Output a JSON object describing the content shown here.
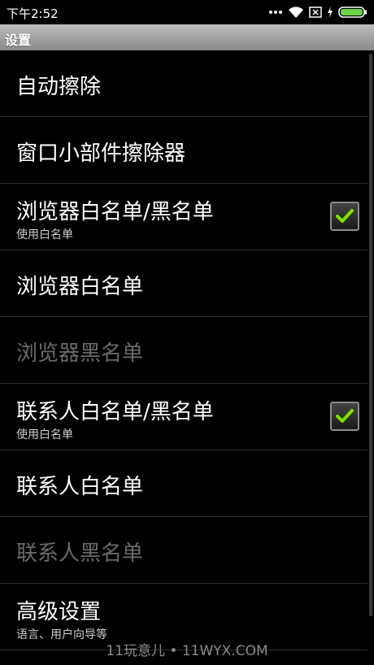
{
  "status_bar": {
    "time": "下午2:52",
    "icons": [
      "signal-icon",
      "wifi-icon",
      "close-box-icon",
      "charging-icon",
      "battery-icon"
    ]
  },
  "title_bar": {
    "title": "设置"
  },
  "items": [
    {
      "title": "自动擦除",
      "summary": "",
      "enabled": true
    },
    {
      "title": "窗口小部件擦除器",
      "summary": "",
      "enabled": true
    },
    {
      "title": "浏览器白名单/黑名单",
      "summary": "使用白名单",
      "enabled": true,
      "checked": true
    },
    {
      "title": "浏览器白名单",
      "summary": "",
      "enabled": true
    },
    {
      "title": "浏览器黑名单",
      "summary": "",
      "enabled": false
    },
    {
      "title": "联系人白名单/黑名单",
      "summary": "使用白名单",
      "enabled": true,
      "checked": true
    },
    {
      "title": "联系人白名单",
      "summary": "",
      "enabled": true
    },
    {
      "title": "联系人黑名单",
      "summary": "",
      "enabled": false
    },
    {
      "title": "高级设置",
      "summary": "语言、用户向导等",
      "enabled": true
    }
  ],
  "watermark": "11玩意儿 • 11WYX.COM",
  "colors": {
    "accent_check": "#7fe000",
    "disabled_text": "#6a6a6a",
    "battery": "#6bd24a"
  }
}
